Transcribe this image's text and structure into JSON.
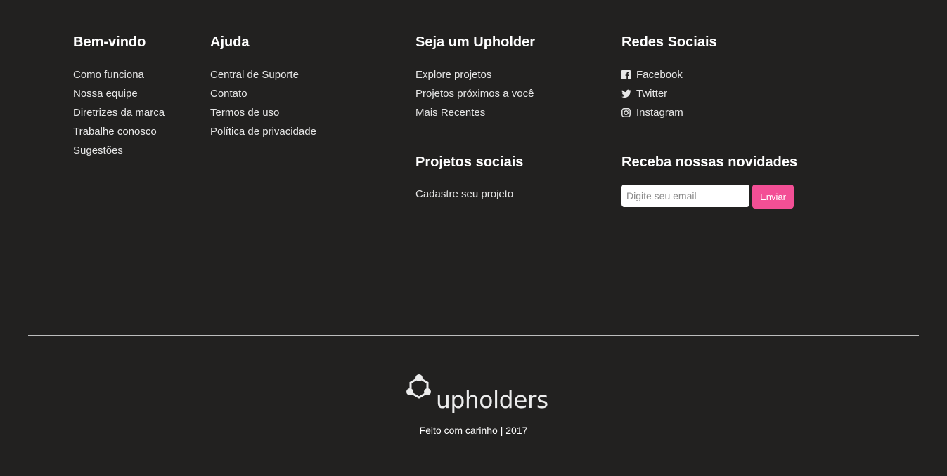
{
  "welcome": {
    "title": "Bem-vindo",
    "links": [
      "Como funciona",
      "Nossa equipe",
      "Diretrizes da marca",
      "Trabalhe conosco",
      "Sugestões"
    ]
  },
  "help": {
    "title": "Ajuda",
    "links": [
      "Central de Suporte",
      "Contato",
      "Termos de uso",
      "Política de privacidade"
    ]
  },
  "upholder": {
    "title": "Seja um Upholder",
    "links": [
      "Explore projetos",
      "Projetos próximos a você",
      "Mais Recentes"
    ]
  },
  "social": {
    "title": "Redes Sociais",
    "links": [
      {
        "label": "Facebook",
        "icon": "facebook-icon"
      },
      {
        "label": "Twitter",
        "icon": "twitter-icon"
      },
      {
        "label": "Instagram",
        "icon": "instagram-icon"
      }
    ]
  },
  "social_projects": {
    "title": "Projetos sociais",
    "links": [
      "Cadastre seu projeto"
    ]
  },
  "newsletter": {
    "title": "Receba nossas novidades",
    "placeholder": "Digite seu email",
    "button_label": "Enviar"
  },
  "brand": {
    "logo_text": "upholders",
    "credits": "Feito com carinho | 2017"
  },
  "colors": {
    "background": "#222120",
    "accent": "#f34f95",
    "text": "#ffffff"
  }
}
